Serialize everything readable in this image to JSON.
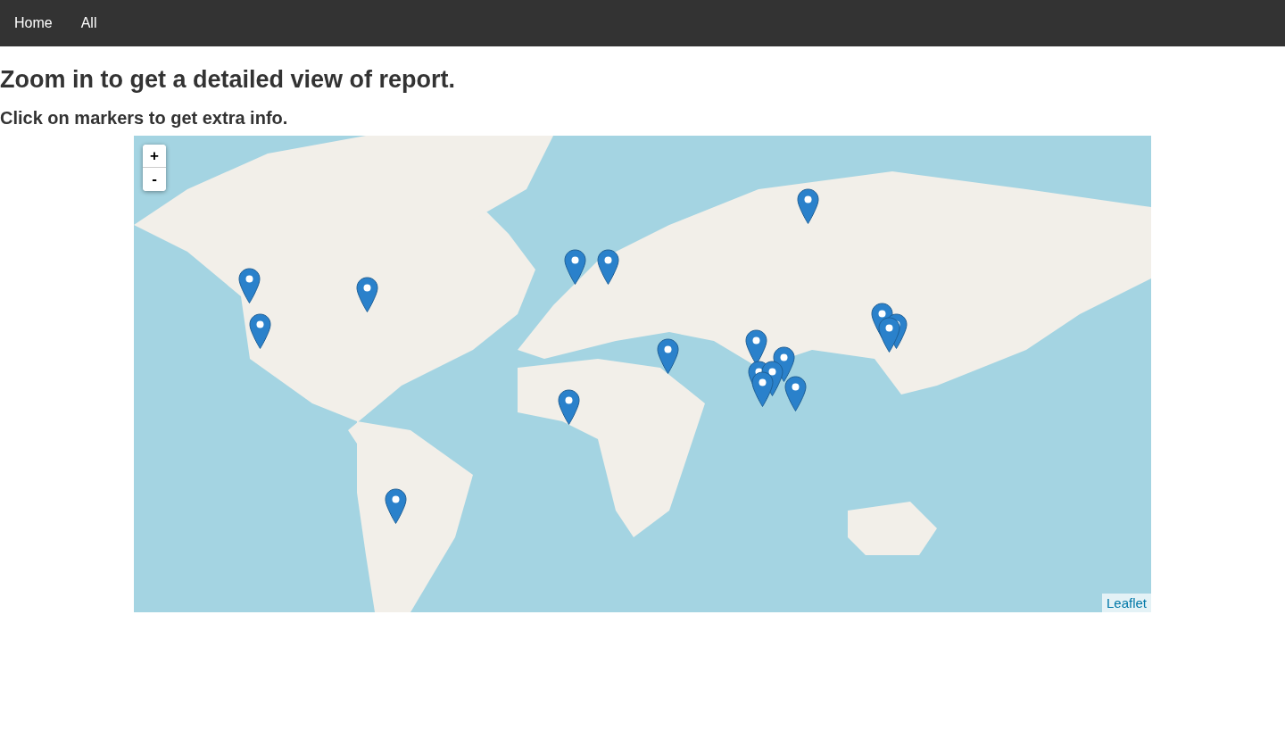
{
  "navbar": {
    "links": [
      {
        "label": "Home"
      },
      {
        "label": "All"
      }
    ]
  },
  "heading": "Zoom in to get a detailed view of report.",
  "subheading": "Click on markers to get extra info.",
  "map": {
    "zoom_in": "+",
    "zoom_out": "-",
    "attribution": "Leaflet"
  }
}
